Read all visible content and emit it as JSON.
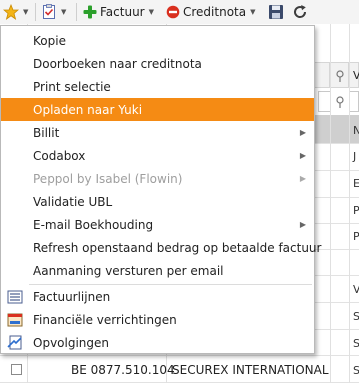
{
  "toolbar": {
    "star_icon": "star-icon",
    "checklist_icon": "checklist-icon",
    "factuur_label": "Factuur",
    "creditnota_label": "Creditnota",
    "save_icon": "floppy-disk-icon",
    "refresh_icon": "refresh-icon",
    "colors": {
      "add": "#2ca02c",
      "delete": "#d9301f",
      "star": "#f3b416"
    }
  },
  "menu": {
    "highlight_color": "#f58b14",
    "items": [
      {
        "label": "Kopie"
      },
      {
        "label": "Doorboeken naar creditnota"
      },
      {
        "label": "Print selectie"
      },
      {
        "label": "Opladen naar Yuki",
        "highlighted": true
      },
      {
        "label": "Billit",
        "submenu": true
      },
      {
        "label": "Codabox",
        "submenu": true
      },
      {
        "label": "Peppol by Isabel (Flowin)",
        "submenu": true,
        "disabled": true
      },
      {
        "label": "Validatie UBL"
      },
      {
        "label": "E-mail Boekhouding",
        "submenu": true
      },
      {
        "label": "Refresh openstaand bedrag op betaalde factuur"
      },
      {
        "label": "Aanmaning versturen per email"
      },
      {
        "label": "Factuurlijnen",
        "icon": "list-icon"
      },
      {
        "label": "Financiële verrichtingen",
        "icon": "ledger-icon"
      },
      {
        "label": "Opvolgingen",
        "icon": "followup-icon"
      }
    ]
  },
  "grid": {
    "header_right": "V",
    "edge_letters": [
      "N",
      "J",
      "E",
      "P",
      "P",
      "V",
      "S",
      "S"
    ],
    "last_row": {
      "vat": "BE 0877.510.104",
      "name": "SECUREX INTERNATIONAL",
      "edge": "S"
    }
  }
}
